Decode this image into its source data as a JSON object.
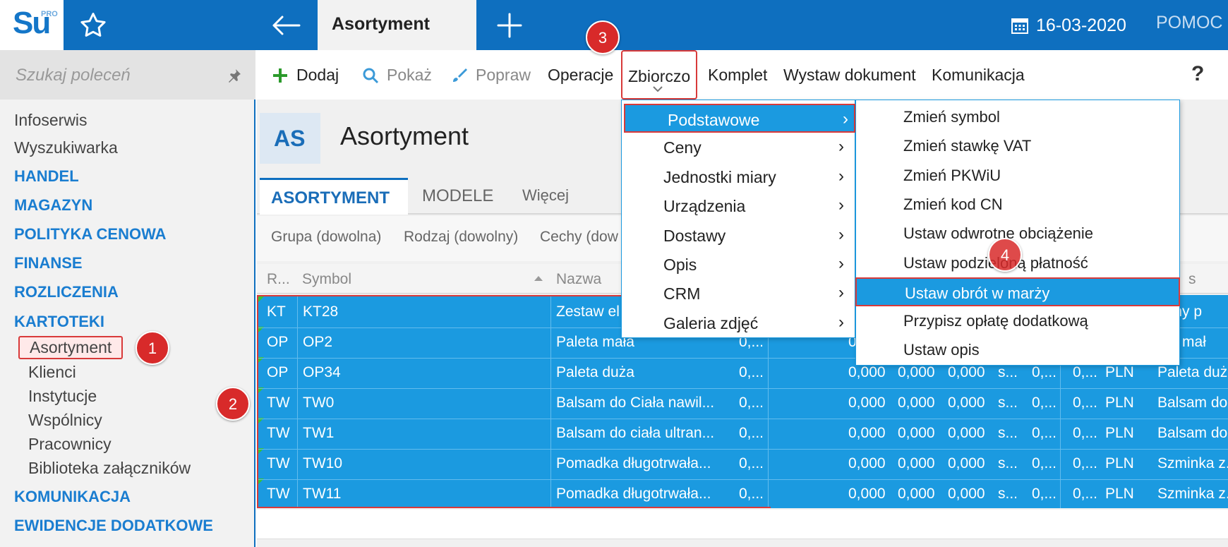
{
  "topbar": {
    "logo_text": "Su",
    "logo_badge": "PRO",
    "active_tab": "Asortyment",
    "date": "16-03-2020",
    "help": "POMOC"
  },
  "sidebar": {
    "search_placeholder": "Szukaj poleceń",
    "items": [
      {
        "label": "Infoserwis",
        "kind": "item"
      },
      {
        "label": "Wyszukiwarka",
        "kind": "item"
      },
      {
        "label": "HANDEL",
        "kind": "head"
      },
      {
        "label": "MAGAZYN",
        "kind": "head"
      },
      {
        "label": "POLITYKA CENOWA",
        "kind": "head"
      },
      {
        "label": "FINANSE",
        "kind": "head"
      },
      {
        "label": "ROZLICZENIA",
        "kind": "head"
      },
      {
        "label": "KARTOTEKI",
        "kind": "head"
      },
      {
        "label": "Asortyment",
        "kind": "sub"
      },
      {
        "label": "Klienci",
        "kind": "sub"
      },
      {
        "label": "Instytucje",
        "kind": "sub"
      },
      {
        "label": "Wspólnicy",
        "kind": "sub"
      },
      {
        "label": "Pracownicy",
        "kind": "sub"
      },
      {
        "label": "Biblioteka załączników",
        "kind": "sub"
      },
      {
        "label": "KOMUNIKACJA",
        "kind": "head"
      },
      {
        "label": "EWIDENCJE DODATKOWE",
        "kind": "head"
      }
    ]
  },
  "toolbar": {
    "add": "Dodaj",
    "show": "Pokaż",
    "edit": "Popraw",
    "operations": "Operacje",
    "bulk": "Zbiorczo",
    "set": "Komplet",
    "issue_doc": "Wystaw dokument",
    "communication": "Komunikacja",
    "help": "?"
  },
  "header": {
    "badge": "AS",
    "title": "Asortyment"
  },
  "tabs": [
    "ASORTYMENT",
    "MODELE",
    "Więcej"
  ],
  "filters": [
    "Grupa (dowolna)",
    "Rodzaj (dowolny)",
    "Cechy (dow"
  ],
  "table": {
    "headers": [
      "R...",
      "Symbol",
      "Nazwa",
      "s"
    ],
    "rows": [
      {
        "r": "KT",
        "symbol": "KT28",
        "name": "Zestaw el",
        "c1": "",
        "c2": "",
        "c3": "",
        "c4": "",
        "c5": "",
        "c6": "",
        "c7": "",
        "c8": "",
        "c9": "fumy p"
      },
      {
        "r": "OP",
        "symbol": "OP2",
        "name": "Paleta mała",
        "c1": "0,...",
        "c2": "0",
        "c3": "",
        "c4": "",
        "c5": "",
        "c6": "",
        "c7": "",
        "c8": "",
        "c9": "eta mał"
      },
      {
        "r": "OP",
        "symbol": "OP34",
        "name": "Paleta duża",
        "c1": "0,...",
        "c2": "0,000",
        "c3": "0,000",
        "c4": "0,000",
        "c5": "s...",
        "c6": "0,...",
        "c7": "0,...",
        "c8": "PLN",
        "c9": "Paleta duż"
      },
      {
        "r": "TW",
        "symbol": "TW0",
        "name": "Balsam do Ciała nawil...",
        "c1": "0,...",
        "c2": "0,000",
        "c3": "0,000",
        "c4": "0,000",
        "c5": "s...",
        "c6": "0,...",
        "c7": "0,...",
        "c8": "PLN",
        "c9": "Balsam do"
      },
      {
        "r": "TW",
        "symbol": "TW1",
        "name": "Balsam do ciała ultran...",
        "c1": "0,...",
        "c2": "0,000",
        "c3": "0,000",
        "c4": "0,000",
        "c5": "s...",
        "c6": "0,...",
        "c7": "0,...",
        "c8": "PLN",
        "c9": "Balsam do"
      },
      {
        "r": "TW",
        "symbol": "TW10",
        "name": "Pomadka długotrwała...",
        "c1": "0,...",
        "c2": "0,000",
        "c3": "0,000",
        "c4": "0,000",
        "c5": "s...",
        "c6": "0,...",
        "c7": "0,...",
        "c8": "PLN",
        "c9": "Szminka z."
      },
      {
        "r": "TW",
        "symbol": "TW11",
        "name": "Pomadka długotrwała...",
        "c1": "0,...",
        "c2": "0,000",
        "c3": "0,000",
        "c4": "0,000",
        "c5": "s...",
        "c6": "0,...",
        "c7": "0,...",
        "c8": "PLN",
        "c9": "Szminka z."
      }
    ]
  },
  "menu_main": [
    {
      "label": "Podstawowe",
      "arrow": "›"
    },
    {
      "label": "Ceny",
      "arrow": "›"
    },
    {
      "label": "Jednostki miary",
      "arrow": "›"
    },
    {
      "label": "Urządzenia",
      "arrow": "›"
    },
    {
      "label": "Dostawy",
      "arrow": "›"
    },
    {
      "label": "Opis",
      "arrow": "›"
    },
    {
      "label": "CRM",
      "arrow": "›"
    },
    {
      "label": "Galeria zdjęć",
      "arrow": "›"
    }
  ],
  "menu_sub": [
    "Zmień symbol",
    "Zmień stawkę VAT",
    "Zmień PKWiU",
    "Zmień kod CN",
    "Ustaw odwrotne obciążenie",
    "Ustaw podzieloną płatność",
    "Ustaw obrót w marży",
    "Przypisz opłatę dodatkową",
    "Ustaw opis"
  ],
  "callouts": [
    "1",
    "2",
    "3",
    "4"
  ],
  "colors": {
    "brand": "#0e6fbf",
    "selection": "#1b9ae0",
    "highlight_border": "#d83a3a"
  }
}
